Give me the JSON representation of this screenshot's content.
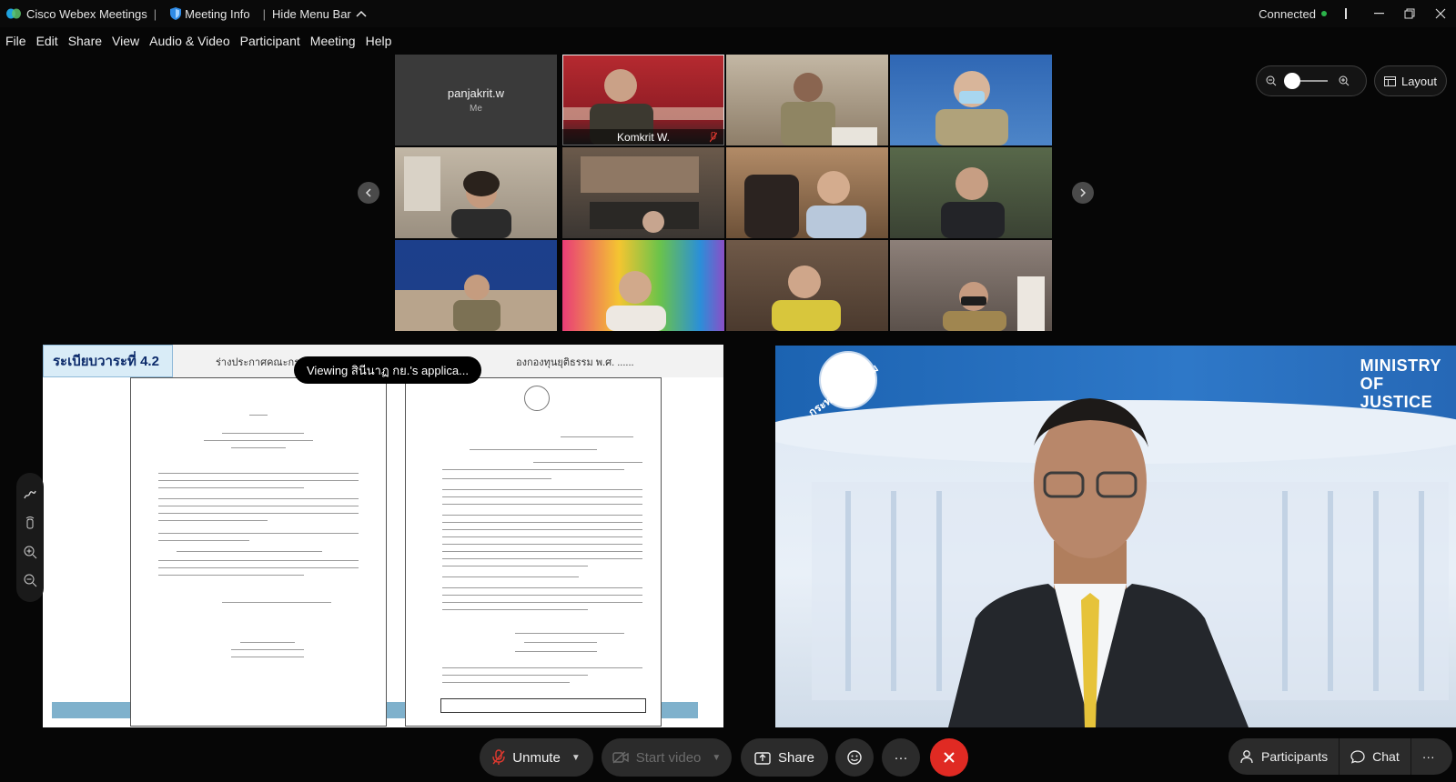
{
  "titlebar": {
    "app_name": "Cisco Webex Meetings",
    "meeting_info": "Meeting Info",
    "hide_menu": "Hide Menu Bar",
    "separator": "|",
    "status": "Connected"
  },
  "menu": [
    "File",
    "Edit",
    "Share",
    "View",
    "Audio & Video",
    "Participant",
    "Meeting",
    "Help"
  ],
  "grid": {
    "me_name": "panjakrit.w",
    "me_sub": "Me",
    "active_name": "Komkrit W."
  },
  "tiles": [
    {
      "kind": "me",
      "bg": "#3a3a3a"
    },
    {
      "kind": "active",
      "bg": "#b0262e"
    },
    {
      "kind": "video",
      "bg": "#9f8f79"
    },
    {
      "kind": "video",
      "bg": "#3f73b6"
    },
    {
      "kind": "video",
      "bg": "#a99c8c"
    },
    {
      "kind": "video",
      "bg": "#5b4f45"
    },
    {
      "kind": "video",
      "bg": "#8c6d50"
    },
    {
      "kind": "video",
      "bg": "#4d5a47"
    },
    {
      "kind": "video",
      "bg": "#1d3f8a"
    },
    {
      "kind": "video",
      "bg": "#d8c23a"
    },
    {
      "kind": "video",
      "bg": "#6a5444"
    },
    {
      "kind": "video",
      "bg": "#7a6e66"
    }
  ],
  "layout_label": "Layout",
  "share": {
    "agenda_tag": "ระเบียบวาระที่ 4.2",
    "agenda_text": "ร่างประกาศคณะกรรมการกองทุน",
    "agenda_text2": "องกองทุนยุติธรรม พ.ศ. ......",
    "viewing": "Viewing สินีนาฏ กย.'s applica..."
  },
  "speaker": {
    "ministry_line1": "MINISTRY",
    "ministry_line2": "OF",
    "ministry_line3": "JUSTICE",
    "seal_text": "กระทรวงยุติธรรม"
  },
  "controls": {
    "unmute": "Unmute",
    "start_video": "Start video",
    "share": "Share",
    "more": "···",
    "participants": "Participants",
    "chat": "Chat"
  },
  "colors": {
    "end_button": "#e02a23",
    "connected_dot": "#2bb34a",
    "mic_off": "#e0392f"
  }
}
